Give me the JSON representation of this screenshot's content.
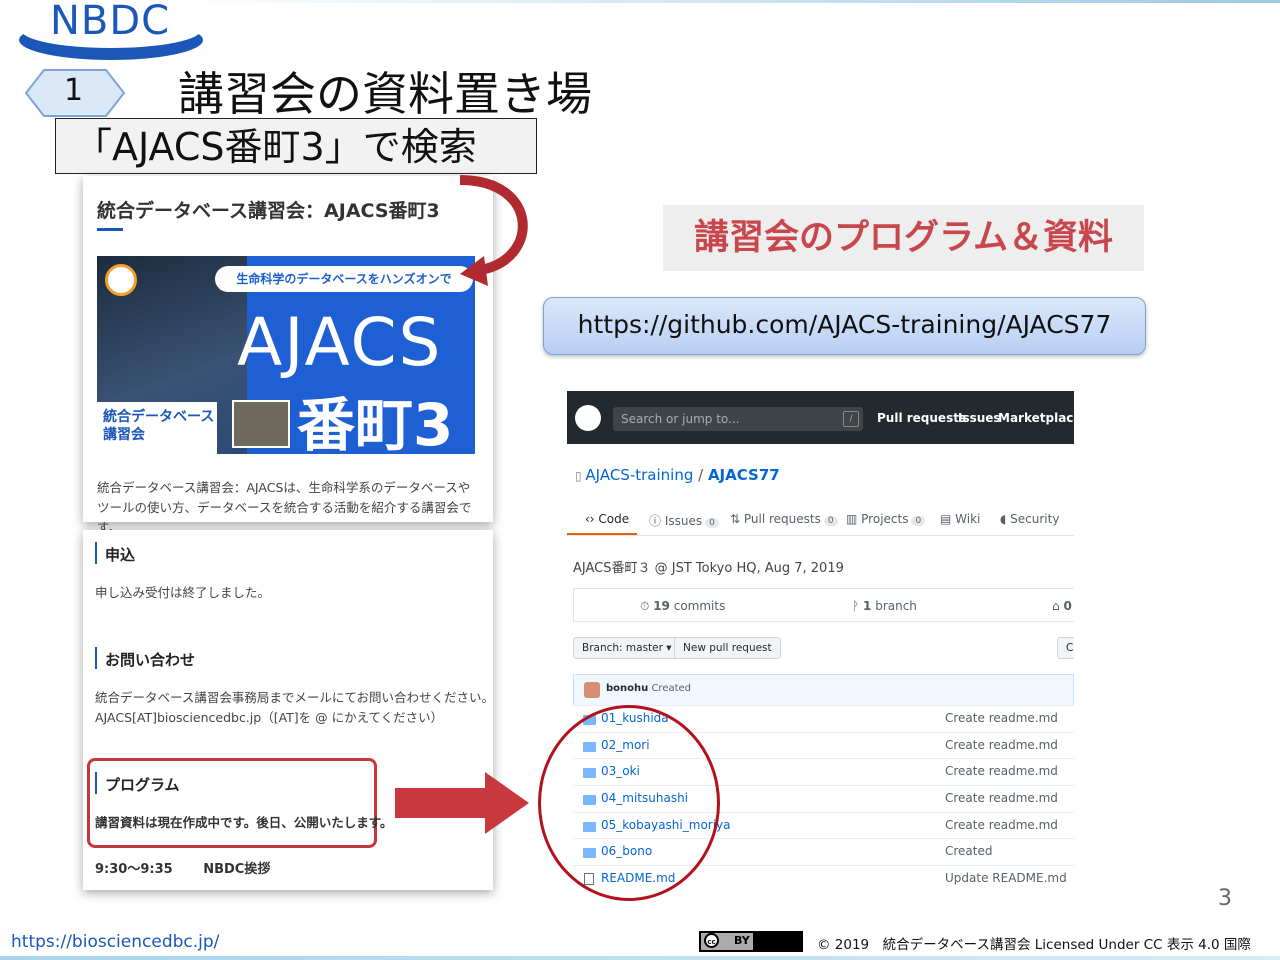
{
  "header": {
    "logo_text": "NBDC",
    "badge_number": "1",
    "title": "講習会の資料置き場",
    "search_hint": "「AJACS番町3」で検索"
  },
  "left_page": {
    "title": "統合データベース講習会：AJACS番町3",
    "banner": {
      "pill": "生命科学のデータベースをハンズオンで",
      "big": "AJACS",
      "bancho": "番町3",
      "sub_line1": "統合データベース",
      "sub_line2": "講習会"
    },
    "description": "統合データベース講習会：AJACSは、生命科学系のデータベースやツールの使い方、データベースを統合する活動を紹介する講習会です。",
    "apply_heading": "申込",
    "apply_text": "申し込み受付は終了しました。",
    "contact_heading": "お問い合わせ",
    "contact_line1": "統合データベース講習会事務局までメールにてお問い合わせください。",
    "contact_line2": "AJACS[AT]biosciencedbc.jp（[AT]を @ にかえてください）",
    "program_heading": "プログラム",
    "program_text": "講習資料は現在作成中です。後日、公開いたします。",
    "time": "9:30〜9:35",
    "time_label": "NBDC挨拶"
  },
  "right": {
    "program_label": "講習会のプログラム＆資料",
    "url": "https://github.com/AJACS-training/AJACS77"
  },
  "github": {
    "search_placeholder": "Search or jump to...",
    "slash_key": "/",
    "nav": [
      "Pull requests",
      "Issues",
      "Marketplace"
    ],
    "repo_owner": "AJACS-training",
    "repo_sep": " / ",
    "repo_name": "AJACS77",
    "tabs": [
      {
        "label": "Code",
        "count": ""
      },
      {
        "label": "Issues",
        "count": "0"
      },
      {
        "label": "Pull requests",
        "count": "0"
      },
      {
        "label": "Projects",
        "count": "0"
      },
      {
        "label": "Wiki",
        "count": ""
      },
      {
        "label": "Security",
        "count": ""
      }
    ],
    "description": "AJACS番町３ @ JST Tokyo HQ, Aug 7, 2019",
    "commits_count": "19",
    "commits_label": "commits",
    "branch_count": "1",
    "branch_label": "branch",
    "releases_count": "0",
    "branch_button": "Branch: master ▾",
    "new_pr_button": "New pull request",
    "clone_button": "C",
    "commit_user": "bonohu",
    "commit_msg": "Created",
    "files": [
      {
        "name": "01_kushida",
        "msg": "Create readme.md"
      },
      {
        "name": "02_mori",
        "msg": "Create readme.md"
      },
      {
        "name": "03_oki",
        "msg": "Create readme.md"
      },
      {
        "name": "04_mitsuhashi",
        "msg": "Create readme.md"
      },
      {
        "name": "05_kobayashi_moriya",
        "msg": "Create readme.md"
      },
      {
        "name": "06_bono",
        "msg": "Created"
      },
      {
        "name": "README.md",
        "msg": "Update README.md"
      }
    ]
  },
  "footer": {
    "page_number": "3",
    "url": "https://biosciencedbc.jp/",
    "cc_badge": "BY",
    "cc_symbol": "cc",
    "copyright": "© 2019　統合データベース講習会 Licensed Under CC 表示 4.0 国際"
  },
  "colors": {
    "brand_blue": "#1a57b8",
    "accent_red": "#c8474d",
    "github_dark": "#24292e",
    "link_blue": "#0366d6"
  }
}
